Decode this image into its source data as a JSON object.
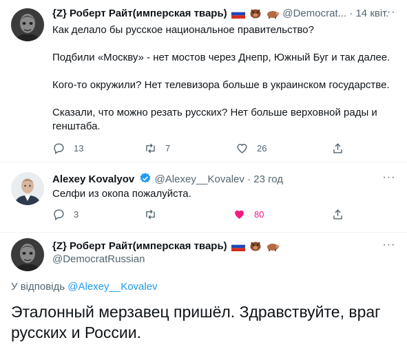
{
  "colors": {
    "text": "#0f1419",
    "secondary": "#536471",
    "link": "#1d9bf0",
    "like": "#f91880",
    "line": "#cfd9de"
  },
  "tweet1": {
    "name": "{Z} Роберт Райт(имперская тварь)",
    "handle": "@Democrat...",
    "dot": "·",
    "date": "14 квіт.",
    "paragraphs": [
      "Как делало бы русское национальное правительство?",
      "Подбили «Москву» - нет мостов через Днепр, Южный Буг и так далее.",
      "Кого-то окружили? Нет телевизора больше в украинском государстве.",
      "Сказали, что можно резать русских? Нет больше верховной рады и генштаба."
    ],
    "replies": "13",
    "retweets": "7",
    "likes": "26"
  },
  "tweet2": {
    "name": "Alexey Kovalyov",
    "handle": "@Alexey__Kovalev",
    "dot": "·",
    "date": "23 год",
    "text": "Селфи из окопа пожалуйста.",
    "replies": "3",
    "retweets": "",
    "likes": "80"
  },
  "tweet3": {
    "name": "{Z} Роберт Райт(имперская тварь)",
    "handle": "@DemocratRussian",
    "reply_prefix": "У відповідь",
    "reply_handle": "@Alexey__Kovalev",
    "text": "Эталонный мерзавец пришёл. Здравствуйте, враг русских и России."
  },
  "icons": {
    "more": "more-horizontal-icon",
    "reply": "reply-icon",
    "retweet": "retweet-icon",
    "like": "heart-icon",
    "share": "share-icon",
    "verified": "verified-badge-icon",
    "flag": "russia-flag-icon",
    "pig": "pig-icon",
    "boar": "boar-icon"
  }
}
